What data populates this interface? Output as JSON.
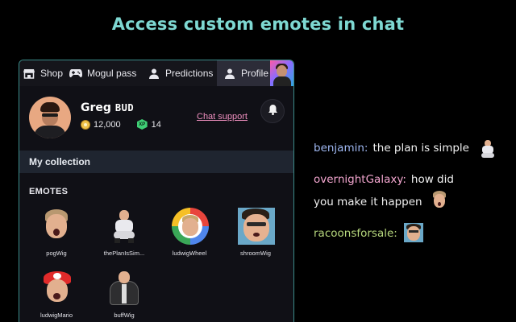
{
  "headline": "Access custom emotes in chat",
  "tabs": [
    {
      "label": "Shop",
      "icon": "store-icon"
    },
    {
      "label": "Mogul pass",
      "icon": "gamepad-icon"
    },
    {
      "label": "Predictions",
      "icon": "person-icon"
    },
    {
      "label": "Profile",
      "icon": "person-icon",
      "active": true
    }
  ],
  "profile": {
    "name": "Greg",
    "tag": "BUD",
    "coins": "12,000",
    "xp_badge": "XP",
    "xp": "14",
    "chat_support": "Chat support"
  },
  "collection": {
    "title": "My collection",
    "emotes_title": "EMOTES",
    "emotes": [
      {
        "name": "pogWig"
      },
      {
        "name": "thePlanIsSim..."
      },
      {
        "name": "ludwigWheel"
      },
      {
        "name": "shroomWig"
      },
      {
        "name": "ludwigMario"
      },
      {
        "name": "buffWig"
      }
    ]
  },
  "chat": [
    {
      "user": "benjamin:",
      "user_color": "#9fb8f2",
      "message_1": "the plan is simple",
      "message_2": ""
    },
    {
      "user": "overnightGalaxy:",
      "user_color": "#f3a6cf",
      "message_1": "how did",
      "message_2": "you make it happen"
    },
    {
      "user": "racoonsforsale:",
      "user_color": "#b8d97e",
      "message_1": "",
      "message_2": ""
    }
  ],
  "colors": {
    "headline": "#7ed8d2",
    "panel_border": "#3b8b88",
    "chat_support": "#ef8fbf"
  }
}
